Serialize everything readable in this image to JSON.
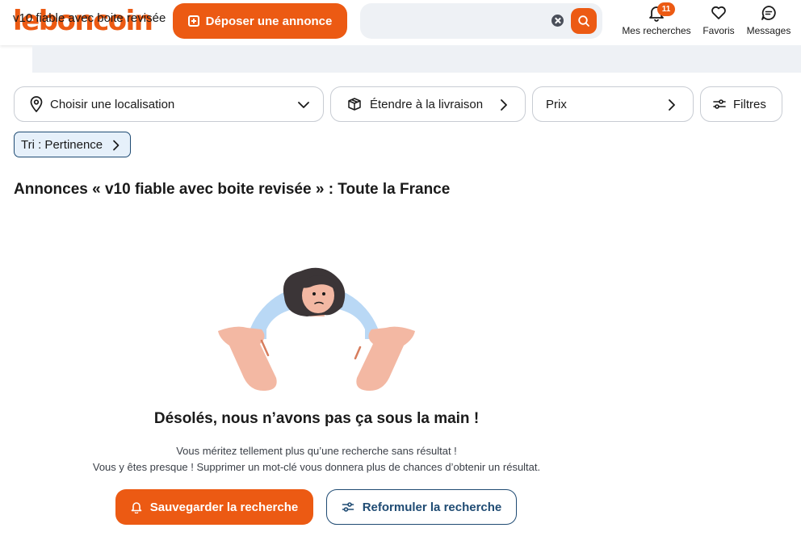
{
  "header": {
    "logo": "leboncoin",
    "post_ad_label": "Déposer une annonce",
    "search_value": "v10 fiable avec boite revisée",
    "nav": {
      "searches_label": "Mes recherches",
      "searches_badge": "11",
      "favorites_label": "Favoris",
      "messages_label": "Messages"
    }
  },
  "filters": {
    "location_label": "Choisir une localisation",
    "delivery_label": "Étendre à la livraison",
    "price_label": "Prix",
    "filters_label": "Filtres"
  },
  "sort": {
    "label": "Tri : Pertinence"
  },
  "results": {
    "title": "Annonces « v10 fiable avec boite revisée » : Toute la France"
  },
  "empty_state": {
    "heading": "Désolés, nous n’avons pas ça sous la main !",
    "line1": "Vous méritez tellement plus qu’une recherche sans résultat !",
    "line2": "Vous y êtes presque ! Supprimer un mot-clé vous donnera plus de chances d’obtenir un résultat.",
    "save_label": "Sauvegarder la recherche",
    "reformulate_label": "Reformuler la recherche"
  },
  "colors": {
    "brand": "#ec5a13",
    "navy": "#1f4b73",
    "search_bg": "#eef1f5"
  }
}
